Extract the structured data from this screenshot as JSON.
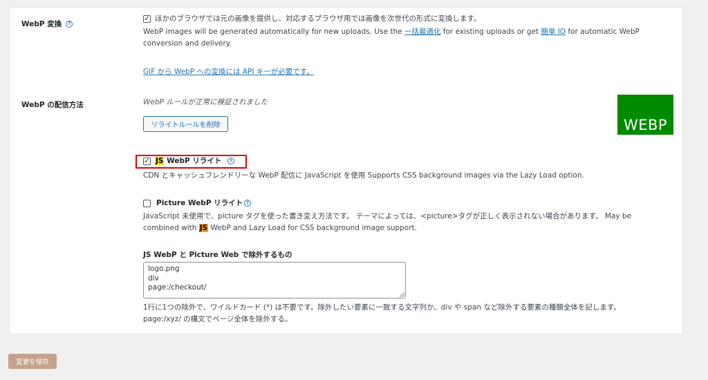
{
  "webp_conversion": {
    "label": "WebP 変換",
    "checkbox_label": "ほかのブラウザでは元の画像を提供し、対応するブラウザ用では画像を次世代の形式に変換します。",
    "desc_part1": "WebP images will be generated automatically for new uploads. Use the ",
    "bulk_link": "一括最適化",
    "desc_part2": " for existing uploads or get ",
    "easyio_link": "簡単 IO",
    "desc_part3": " for automatic WebP",
    "desc_line2": "conversion and delivery.",
    "gif_link": "GIF から WebP への変換には API キーが必要です。"
  },
  "webp_delivery": {
    "label": "WebP の配信方法",
    "verified_text": "WebP ルールが正常に検証されました",
    "remove_button": "リライトルールを削除",
    "logo_text": "WEBP",
    "js": {
      "badge": "JS",
      "label": " WebP リライト",
      "desc": "CDN とキャッシュフレンドリーな WebP 配信に JavaScript を使用 Supports CSS background images via the Lazy Load option."
    },
    "picture": {
      "label": "Picture WebP リライト",
      "desc_line1": "JavaScript 未使用で、picture タグを使った書き変え方法です。 テーマによっては、<picture>タグが正しく表示されない場合があります。 May be",
      "desc_line2_pre": "combined with ",
      "badge": "JS",
      "desc_line2_post": " WebP and Lazy Load for CSS background image support."
    },
    "exclude": {
      "label": "JS WebP と Picture Web で除外するもの",
      "lines": [
        "logo.png",
        "div",
        "page:/checkout/"
      ],
      "help_line1": "1行に1つの除外で、ワイルドカード (*) は不要です。除外したい要素に一致する文字列か、div や span など除外する要素の種類全体を記します。",
      "help_line2": "page:/xyz/ の構文でページ全体を除外する。"
    }
  },
  "save_button": "変更を保存",
  "colors": {
    "accent": "#2271b1",
    "logo_bg": "#008a00",
    "highlight": "#e00000",
    "save_bg": "#c5a38a"
  }
}
